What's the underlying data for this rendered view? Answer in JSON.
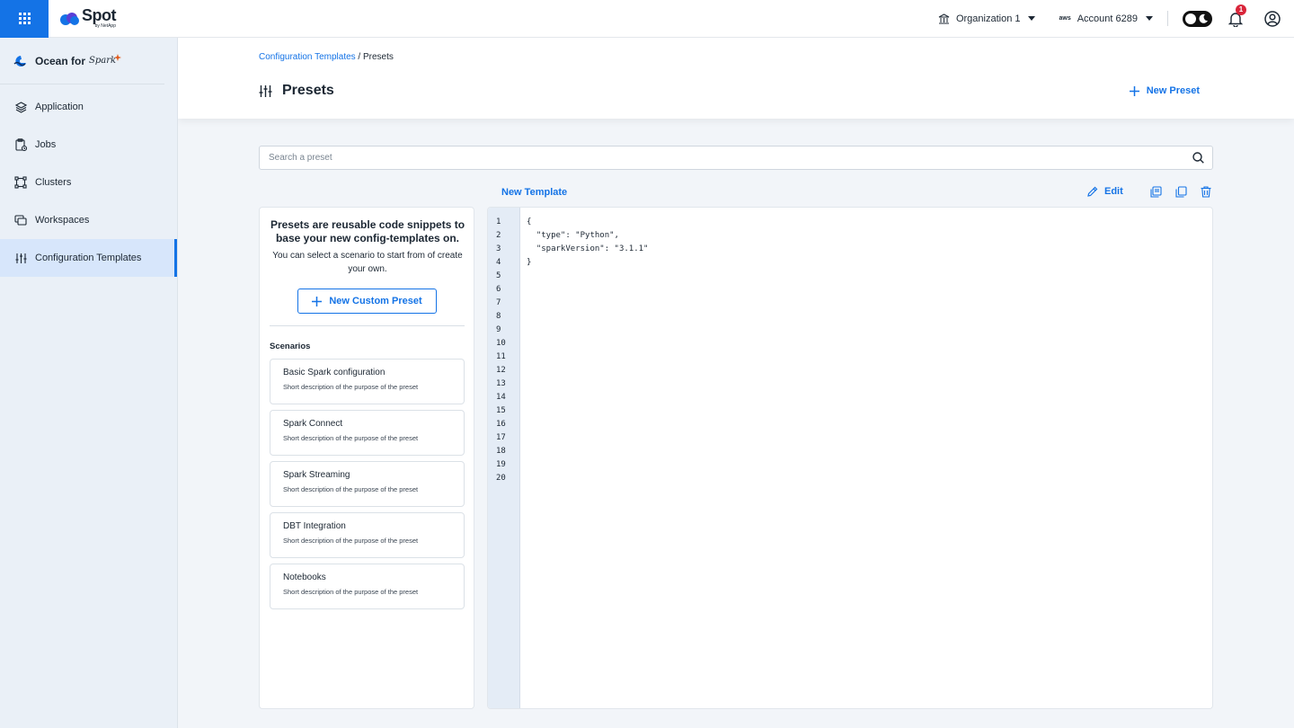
{
  "app": {
    "name": "Spot",
    "by": "by NetApp"
  },
  "topbar": {
    "organization": "Organization 1",
    "account": "Account 6289",
    "aws_label": "aws",
    "notification_count": "1"
  },
  "sidebar": {
    "product": {
      "name": "Ocean for",
      "brand": "Spark"
    },
    "items": [
      {
        "label": "Application",
        "icon": "layers-icon"
      },
      {
        "label": "Jobs",
        "icon": "jobs-icon"
      },
      {
        "label": "Clusters",
        "icon": "clusters-icon"
      },
      {
        "label": "Workspaces",
        "icon": "workspaces-icon"
      },
      {
        "label": "Configuration Templates",
        "icon": "sliders-icon",
        "active": true
      }
    ]
  },
  "header": {
    "breadcrumb": {
      "link": "Configuration Templates",
      "separator": " / ",
      "current": "Presets"
    },
    "title": "Presets",
    "new_preset_label": "New Preset"
  },
  "search": {
    "placeholder": "Search a preset",
    "value": ""
  },
  "intro": {
    "title": "Presets are reusable code snippets to base your new config-templates on.",
    "description": "You can select a scenario to start from of create your own.",
    "custom_button": "New Custom Preset"
  },
  "scenarios": {
    "title": "Scenarios",
    "items": [
      {
        "name": "Basic Spark configuration",
        "description": "Short description of the purpose of the preset"
      },
      {
        "name": "Spark Connect",
        "description": "Short description of the purpose of the preset"
      },
      {
        "name": "Spark Streaming",
        "description": "Short description of the purpose of the preset"
      },
      {
        "name": "DBT Integration",
        "description": "Short description of the purpose of the preset"
      },
      {
        "name": "Notebooks",
        "description": "Short description of the purpose of the preset"
      }
    ]
  },
  "template": {
    "title": "New Template",
    "edit_label": "Edit",
    "line_numbers": [
      "1",
      "2",
      "3",
      "4",
      "5",
      "6",
      "7",
      "8",
      "9",
      "10",
      "11",
      "12",
      "13",
      "14",
      "15",
      "16",
      "17",
      "18",
      "19",
      "20"
    ],
    "code_lines": [
      "{",
      "  \"type\": \"Python\",",
      "  \"sparkVersion\": \"3.1.1\"",
      "}"
    ]
  },
  "colors": {
    "accent": "#1473e6",
    "sidebar_bg": "#eaf0f7",
    "active_bg": "#d7e6fb",
    "badge": "#d9253a"
  }
}
